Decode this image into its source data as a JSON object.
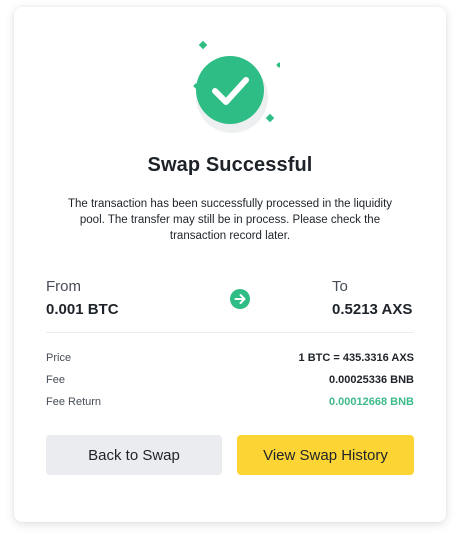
{
  "dialog": {
    "title": "Swap Successful",
    "description": "The transaction has been successfully processed in the liquidity pool. The transfer may still be in process. Please check the transaction record later."
  },
  "swap": {
    "from_label": "From",
    "from_value": "0.001 BTC",
    "to_label": "To",
    "to_value": "0.5213 AXS"
  },
  "details": {
    "price_label": "Price",
    "price_value": "1 BTC = 435.3316 AXS",
    "fee_label": "Fee",
    "fee_value": "0.00025336 BNB",
    "fee_return_label": "Fee Return",
    "fee_return_value": "0.00012668 BNB"
  },
  "buttons": {
    "back_label": "Back to Swap",
    "history_label": "View Swap History"
  },
  "icons": {
    "success": "check-circle-icon",
    "arrow": "arrow-right-icon"
  },
  "colors": {
    "success_green": "#2ebd85",
    "fee_return_green": "#3dba8a",
    "primary_yellow": "#fcd535",
    "secondary_gray": "#eaecef"
  }
}
